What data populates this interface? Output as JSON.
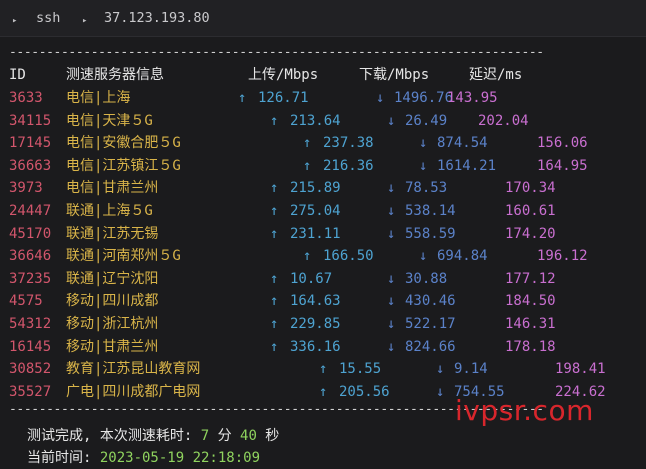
{
  "tab_bar": {
    "arrow1": "▸",
    "title": "ssh",
    "arrow2": "▸",
    "host": "37.123.193.80"
  },
  "separator": "------------------------------------------------------------------------",
  "header": {
    "id": "ID",
    "server": "测速服务器信息",
    "upload": "上传/Mbps",
    "download": "下载/Mbps",
    "latency": "延迟/ms"
  },
  "arrows": {
    "up": "↑",
    "down": "↓"
  },
  "rows": [
    {
      "id": "3633",
      "server": "电信|上海",
      "up": "126.71",
      "down": "1496.76",
      "latency": "143.95"
    },
    {
      "id": "34115",
      "server": "电信|天津５G",
      "up": "213.64",
      "down": "26.49",
      "latency": "202.04"
    },
    {
      "id": "17145",
      "server": "电信|安徽合肥５G",
      "up": "237.38",
      "down": "874.54",
      "latency": "156.06"
    },
    {
      "id": "36663",
      "server": "电信|江苏镇江５G",
      "up": "216.36",
      "down": "1614.21",
      "latency": "164.95"
    },
    {
      "id": "3973",
      "server": "电信|甘肃兰州",
      "up": "215.89",
      "down": "78.53",
      "latency": "170.34"
    },
    {
      "id": "24447",
      "server": "联通|上海５G",
      "up": "275.04",
      "down": "538.14",
      "latency": "160.61"
    },
    {
      "id": "45170",
      "server": "联通|江苏无锡",
      "up": "231.11",
      "down": "558.59",
      "latency": "174.20"
    },
    {
      "id": "36646",
      "server": "联通|河南郑州５G",
      "up": "166.50",
      "down": "694.84",
      "latency": "196.12"
    },
    {
      "id": "37235",
      "server": "联通|辽宁沈阳",
      "up": "10.67",
      "down": "30.88",
      "latency": "177.12"
    },
    {
      "id": "4575",
      "server": "移动|四川成都",
      "up": "164.63",
      "down": "430.46",
      "latency": "184.50"
    },
    {
      "id": "54312",
      "server": "移动|浙江杭州",
      "up": "229.85",
      "down": "522.17",
      "latency": "146.31"
    },
    {
      "id": "16145",
      "server": "移动|甘肃兰州",
      "up": "336.16",
      "down": "824.66",
      "latency": "178.18"
    },
    {
      "id": "30852",
      "server": "教育|江苏昆山教育网",
      "up": "15.55",
      "down": "9.14",
      "latency": "198.41"
    },
    {
      "id": "35527",
      "server": "广电|四川成都广电网",
      "up": "205.56",
      "down": "754.55",
      "latency": "224.62"
    }
  ],
  "footer": {
    "done_label": "测试完成, 本次测速耗时: ",
    "minutes": "7",
    "min_unit": " 分 ",
    "seconds": "40",
    "sec_unit": " 秒",
    "time_label": "当前时间: ",
    "time": "2023-05-19 22:18:09"
  },
  "watermark": "ivpsr.com",
  "colors": {
    "id": "#d2566c",
    "server": "#d9b449",
    "upload": "#4ea3d1",
    "download": "#5b82c9",
    "latency": "#c96fd0",
    "footer_value": "#8fd35e",
    "watermark": "#d8262c"
  }
}
